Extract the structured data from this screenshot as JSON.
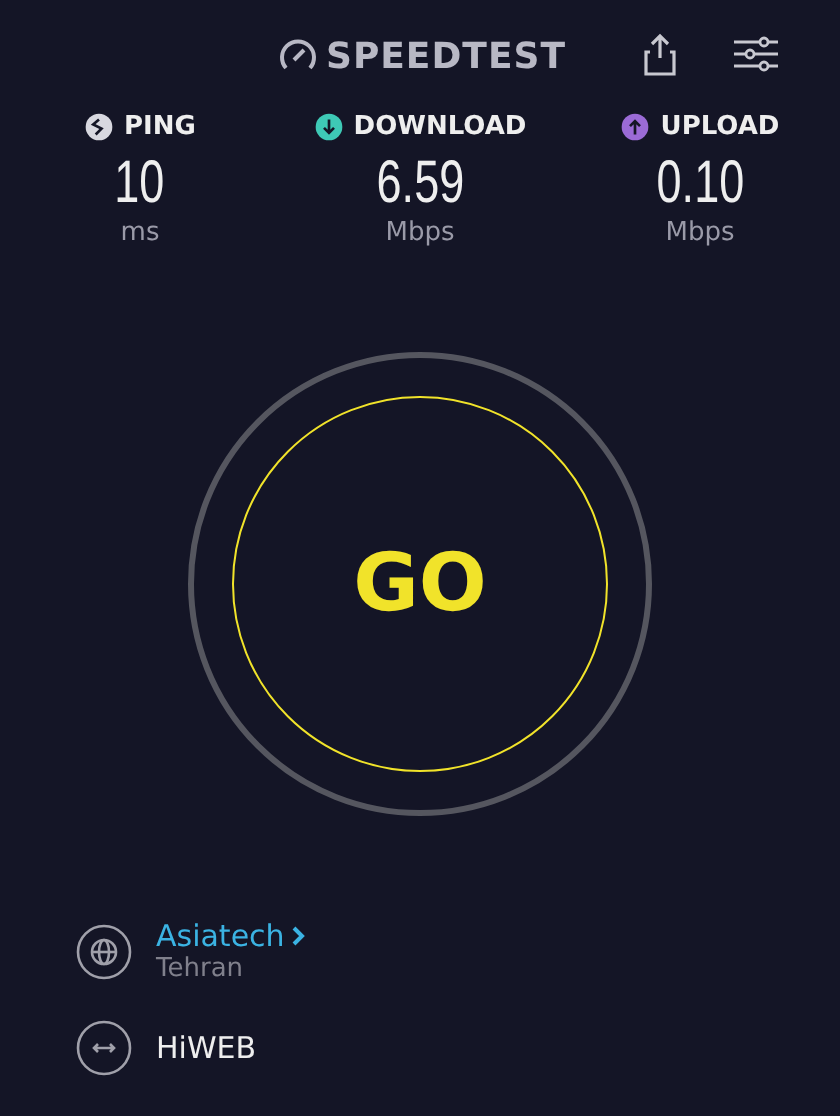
{
  "header": {
    "title": "SPEEDTEST"
  },
  "metrics": [
    {
      "kind": "ping",
      "label": "PING",
      "value": "10",
      "unit": "ms",
      "color": "#d8d8e0"
    },
    {
      "kind": "download",
      "label": "DOWNLOAD",
      "value": "6.59",
      "unit": "Mbps",
      "color": "#3ec9b6"
    },
    {
      "kind": "upload",
      "label": "UPLOAD",
      "value": "0.10",
      "unit": "Mbps",
      "color": "#9b6bd6"
    }
  ],
  "go_button": {
    "label": "GO"
  },
  "server": {
    "name": "Asiatech",
    "location": "Tehran"
  },
  "provider": {
    "name": "HiWEB"
  }
}
